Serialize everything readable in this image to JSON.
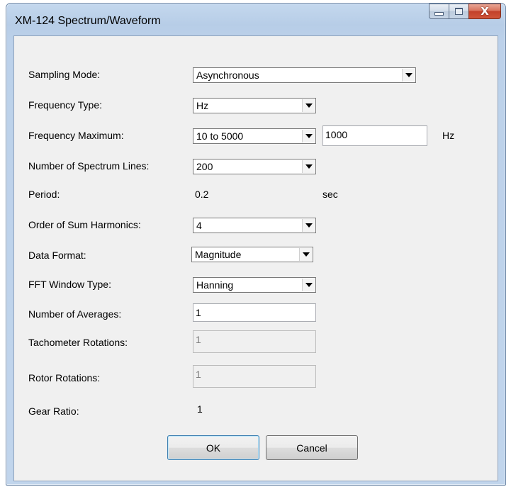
{
  "window": {
    "title": "XM-124 Spectrum/Waveform",
    "caption_buttons": {
      "minimize_icon": "minimize-icon",
      "maximize_icon": "maximize-icon",
      "close_icon": "close-icon",
      "close_glyph": "X"
    }
  },
  "form": {
    "sampling_mode": {
      "label": "Sampling Mode:",
      "value": "Asynchronous"
    },
    "frequency_type": {
      "label": "Frequency Type:",
      "value": "Hz"
    },
    "frequency_maximum": {
      "label": "Frequency Maximum:",
      "range_value": "10 to 5000",
      "value": "1000",
      "unit": "Hz"
    },
    "spectrum_lines": {
      "label": "Number of Spectrum Lines:",
      "value": "200"
    },
    "period": {
      "label": "Period:",
      "value": "0.2",
      "unit": "sec"
    },
    "sum_harmonics": {
      "label": "Order of Sum Harmonics:",
      "value": "4"
    },
    "data_format": {
      "label": "Data Format:",
      "value": "Magnitude"
    },
    "fft_window": {
      "label": "FFT Window Type:",
      "value": "Hanning"
    },
    "averages": {
      "label": "Number of Averages:",
      "value": "1"
    },
    "tachometer_rotations": {
      "label": "Tachometer Rotations:",
      "value": "1"
    },
    "rotor_rotations": {
      "label": "Rotor Rotations:",
      "value": "1"
    },
    "gear_ratio": {
      "label": "Gear Ratio:",
      "value": "1"
    }
  },
  "buttons": {
    "ok": "OK",
    "cancel": "Cancel"
  },
  "colors": {
    "title_bar": "#bcd1ea",
    "client_background": "#f0f0f0",
    "close_button": "#c2412a"
  }
}
